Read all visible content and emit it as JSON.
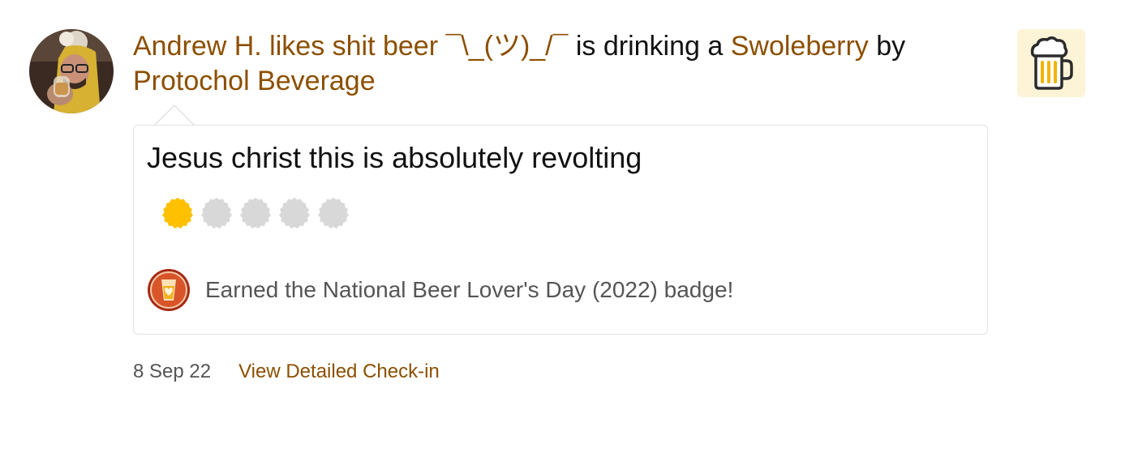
{
  "checkin": {
    "user_name": "Andrew H. likes shit beer ¯\\_(ツ)_/¯",
    "drinking_text": " is drinking a ",
    "beer_name": "Swoleberry",
    "by_text": " by ",
    "brewery_name": "Protochol Beverage",
    "comment": "Jesus christ this is absolutely revolting",
    "rating": 1,
    "rating_max": 5,
    "badge_text": "Earned the National Beer Lover's Day (2022) badge!",
    "date": "8 Sep 22",
    "detail_link": "View Detailed Check-in"
  },
  "colors": {
    "link": "#8c4f00",
    "cap_filled": "#ffc000",
    "cap_empty": "#d8d8d8",
    "beer_badge_bg": "#fdf4d8"
  },
  "icons": {
    "avatar": "user-avatar",
    "beer": "beer-mug-icon",
    "badge": "national-beer-lovers-day-badge-icon",
    "rating": "bottle-cap-icon"
  }
}
